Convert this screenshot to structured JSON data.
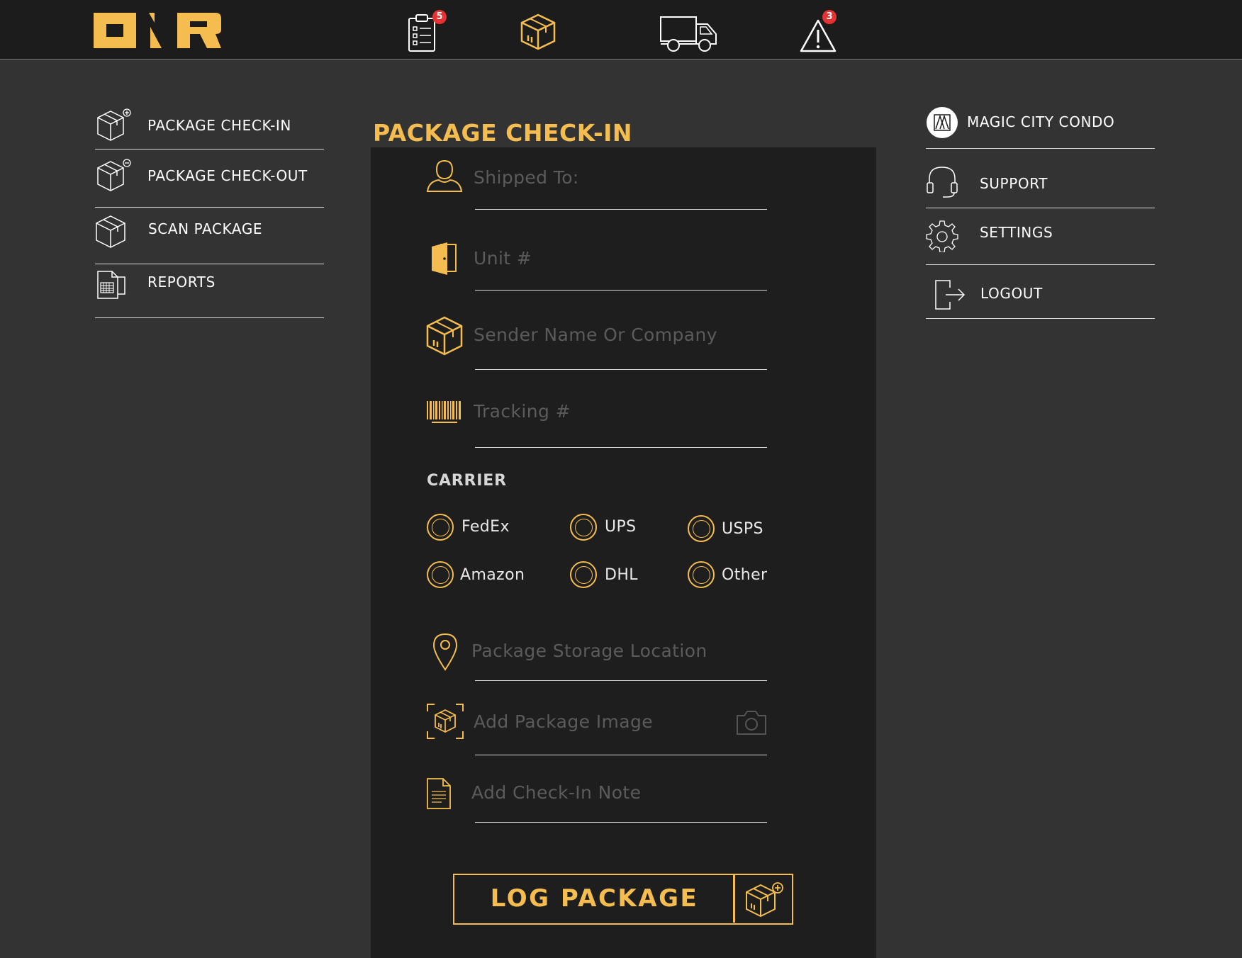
{
  "colors": {
    "accent": "#f5bd4f",
    "badge": "#e63232",
    "topbar": "#1c1c1c",
    "background": "#333333",
    "panel": "#1e1e1e"
  },
  "topbar": {
    "logo_icon": "onr-logo-icon",
    "icons": [
      {
        "name": "checklist-icon",
        "badge": "5"
      },
      {
        "name": "package-icon",
        "badge": ""
      },
      {
        "name": "delivery-truck-icon",
        "badge": ""
      },
      {
        "name": "alert-icon",
        "badge": "3"
      }
    ]
  },
  "sidebar": {
    "items": [
      {
        "label": "PACKAGE CHECK-IN",
        "icon": "package-add-icon"
      },
      {
        "label": "PACKAGE CHECK-OUT",
        "icon": "package-remove-icon"
      },
      {
        "label": "SCAN PACKAGE",
        "icon": "package-icon"
      },
      {
        "label": "REPORTS",
        "icon": "report-icon"
      }
    ]
  },
  "account": {
    "property_name": "MAGIC CITY CONDO",
    "items": [
      {
        "label": "SUPPORT",
        "icon": "headset-icon"
      },
      {
        "label": "SETTINGS",
        "icon": "gear-icon"
      },
      {
        "label": "LOGOUT",
        "icon": "logout-icon"
      }
    ]
  },
  "form": {
    "title": "PACKAGE CHECK-IN",
    "shipped_to": "Shipped To:",
    "unit": "Unit #",
    "sender": "Sender Name Or Company",
    "tracking": "Tracking #",
    "carrier_title": "CARRIER",
    "carriers": [
      "FedEx",
      "UPS",
      "USPS",
      "Amazon",
      "DHL",
      "Other"
    ],
    "storage_location": "Package Storage Location",
    "image": "Add Package Image",
    "note": "Add Check-In Note",
    "submit_label": "LOG PACKAGE"
  }
}
